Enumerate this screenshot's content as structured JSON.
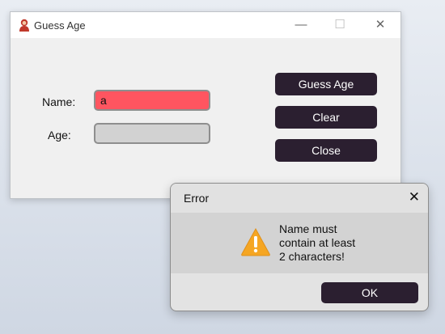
{
  "window": {
    "title": "Guess Age",
    "icon": "person-red-icon",
    "controls": {
      "minimize": "—",
      "maximize": "☐",
      "close": "✕"
    }
  },
  "form": {
    "name_label": "Name:",
    "name_value": "a",
    "age_label": "Age:",
    "age_value": ""
  },
  "buttons": {
    "guess": "Guess Age",
    "clear": "Clear",
    "close": "Close"
  },
  "dialog": {
    "title": "Error",
    "close_glyph": "✕",
    "icon": "warning-icon",
    "message_lines": [
      "Name must",
      "contain at least",
      "2 characters!"
    ],
    "ok": "OK"
  },
  "colors": {
    "button_bg": "#2b1f30",
    "name_error_bg": "#ff5560",
    "age_field_bg": "#d2d2d2",
    "warning": "#f5a623"
  }
}
